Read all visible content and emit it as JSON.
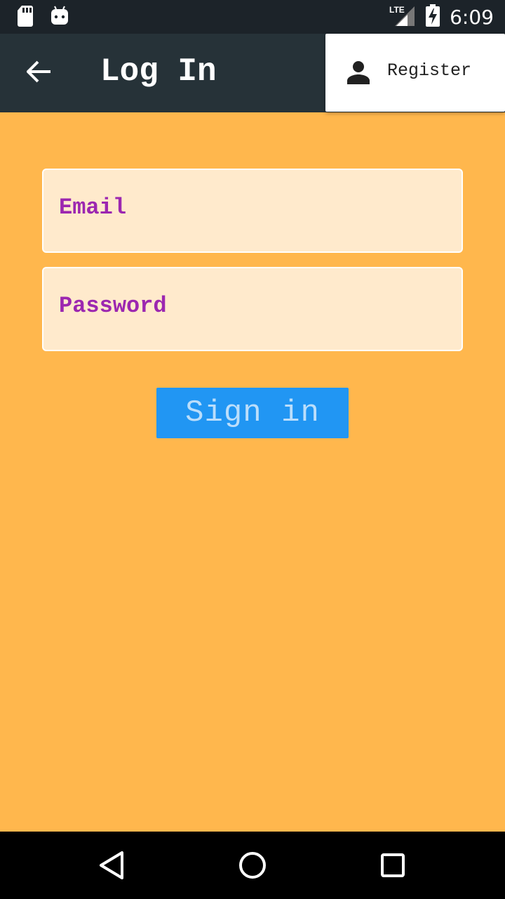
{
  "status_bar": {
    "time": "6:09",
    "network": "LTE",
    "icons": [
      "sd-card-icon",
      "android-icon",
      "lte-signal-icon",
      "battery-charging-icon"
    ]
  },
  "app_bar": {
    "title": "Log In",
    "back_icon": "arrow-back-icon",
    "background": "#263238"
  },
  "overflow_menu": {
    "items": [
      {
        "icon": "person-icon",
        "label": "Register"
      }
    ]
  },
  "form": {
    "email": {
      "placeholder": "Email",
      "value": ""
    },
    "password": {
      "placeholder": "Password",
      "value": ""
    },
    "submit_label": "Sign in"
  },
  "nav_bar": {
    "buttons": [
      "back-triangle-icon",
      "home-circle-icon",
      "recents-square-icon"
    ]
  },
  "colors": {
    "background": "#FFB74D",
    "field_background": "#FFEACC",
    "placeholder": "#9C27B0",
    "button": "#2196F3",
    "button_text": "#BBDEFB"
  }
}
